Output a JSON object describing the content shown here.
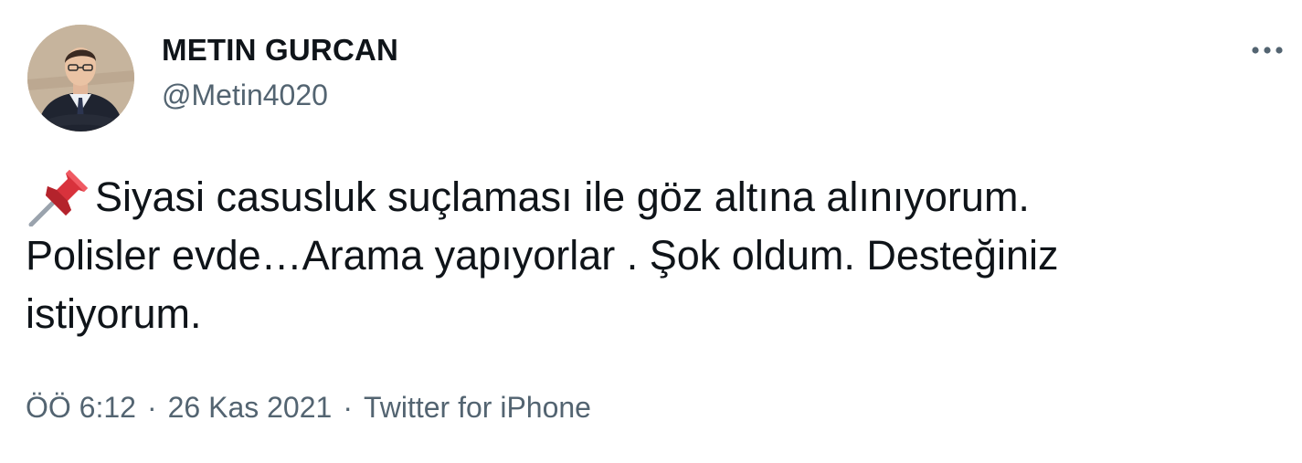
{
  "author": {
    "name": "METIN GURCAN",
    "handle": "@Metin4020"
  },
  "tweet": {
    "emoji_icon": "pushpin-icon",
    "text_line_1": "Siyasi casusluk suçlaması ile göz altına alınıyorum.",
    "text_line_2": "Polisler evde…Arama yapıyorlar . Şok oldum. Desteğiniz",
    "text_line_3": "istiyorum."
  },
  "meta": {
    "time": "ÖÖ 6:12",
    "separator": "·",
    "date": "26 Kas 2021",
    "source": "Twitter for iPhone"
  },
  "colors": {
    "text_primary": "#0f1419",
    "text_secondary": "#536471",
    "pin_red": "#d8323c"
  }
}
